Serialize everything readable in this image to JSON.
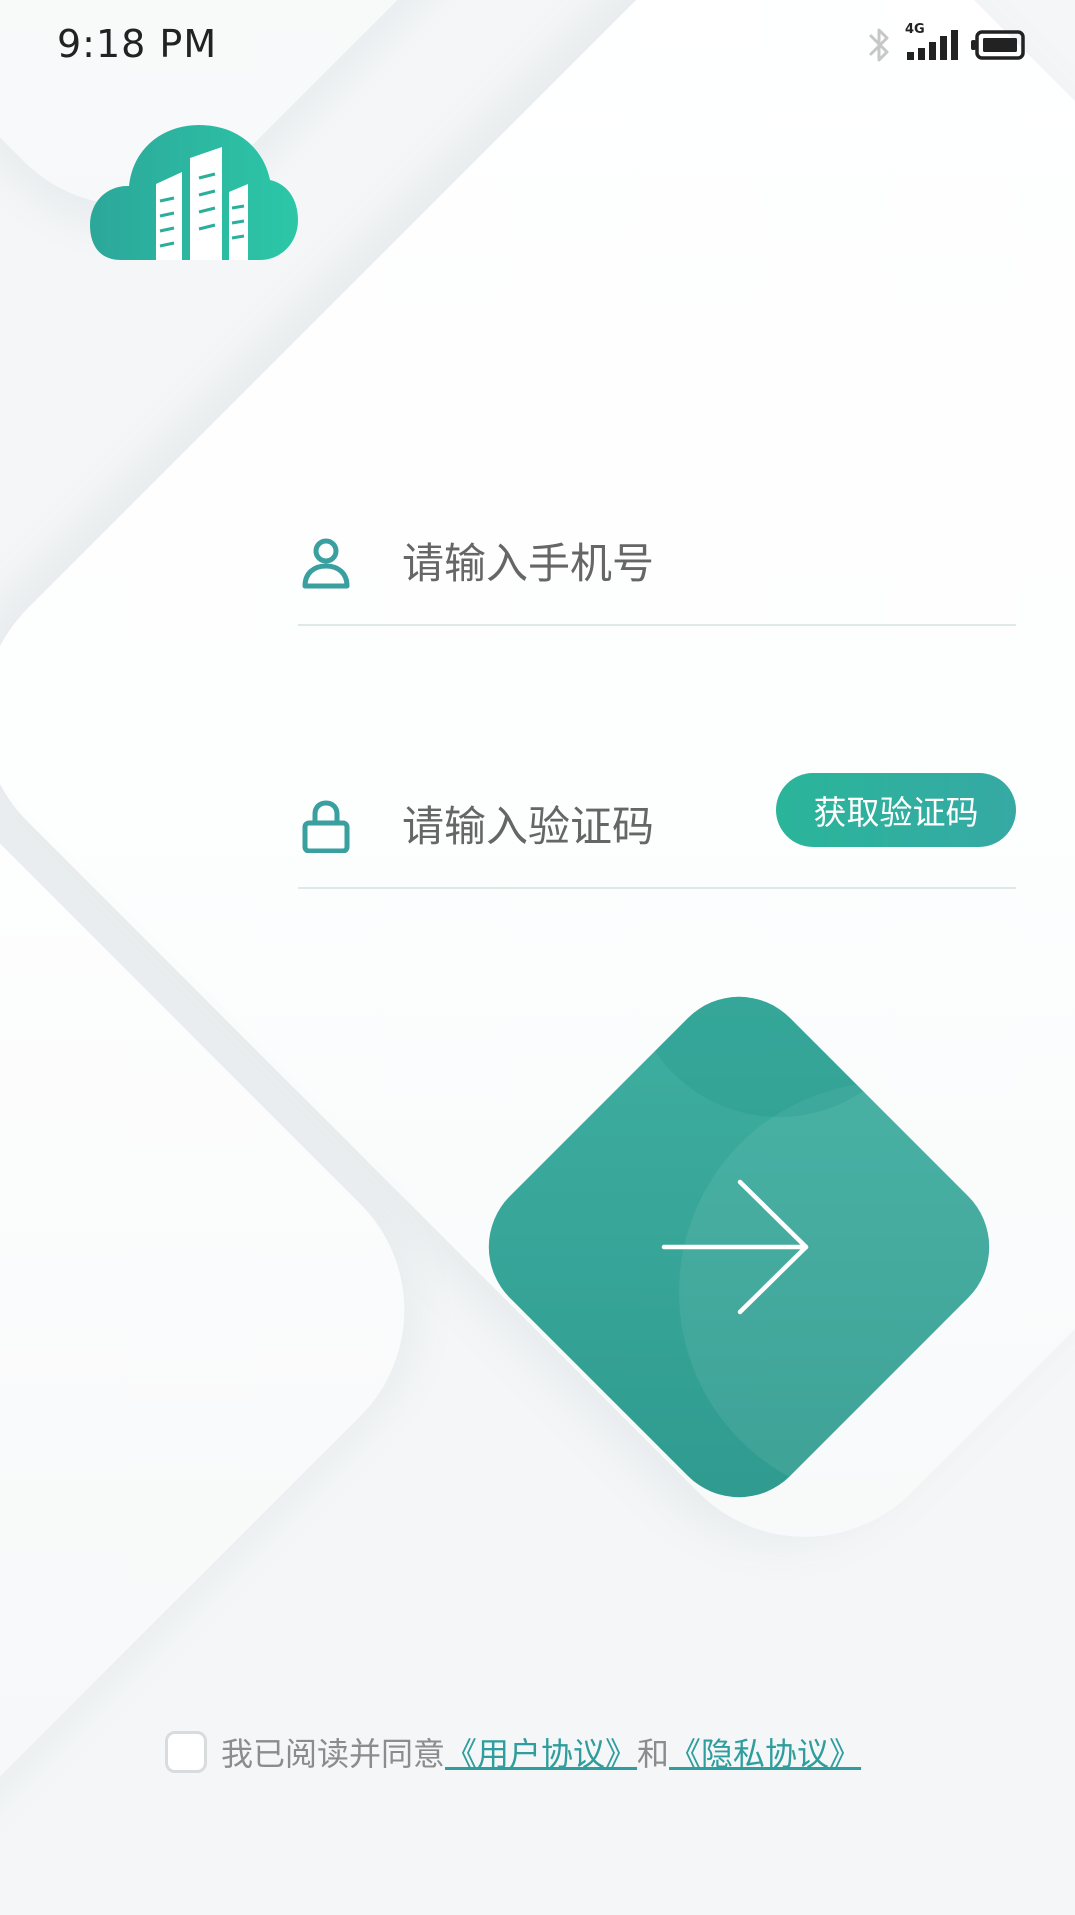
{
  "status_bar": {
    "time": "9:18 PM",
    "network": "4G",
    "icons": [
      "bluetooth-icon",
      "signal-icon",
      "battery-icon"
    ]
  },
  "login_form": {
    "phone": {
      "icon": "user-icon",
      "placeholder": "请输入手机号",
      "value": ""
    },
    "code": {
      "icon": "lock-icon",
      "placeholder": "请输入验证码",
      "value": "",
      "get_code_label": "获取验证码"
    },
    "submit_icon": "arrow-right-icon"
  },
  "agreement": {
    "checked": false,
    "text": "我已阅读并同意",
    "user_agreement": "《用户协议》",
    "connector": "和",
    "privacy_policy": "《隐私协议》"
  },
  "colors": {
    "accent": "#36a99b",
    "accent_dark": "#2f9c91",
    "link": "#2f9d9d"
  }
}
